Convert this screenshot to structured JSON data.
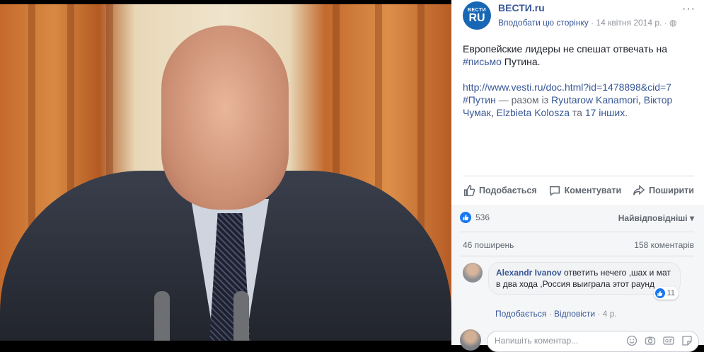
{
  "page": {
    "name": "ВЕСТИ.ru",
    "avatar_top": "ВЕСТИ",
    "avatar_bottom": "RU",
    "follow": "Вподобати цю сторінку",
    "dot": " · ",
    "date": "14 квітня 2014 р.",
    "globe": "· ◍",
    "more": "···"
  },
  "post": {
    "text_before_tag": "Европейские лидеры не спешат отвечать на ",
    "hashtag": "#письмо",
    "text_after_tag": " Путина.",
    "url": "http://www.vesti.ru/doc.html?id=1478898&cid=7",
    "tag2": "#Путин",
    "with": " — разом із ",
    "person1": "Ryutarow Kanamori",
    "comma1": ", ",
    "person2": "Віктор Чумак",
    "comma2": ", ",
    "person3": "Elzbieta Kolosza",
    "and": " та ",
    "others": "17 інших",
    "end": "."
  },
  "actions": {
    "like": "Подобається",
    "comment": "Коментувати",
    "share": "Поширити"
  },
  "stats": {
    "likes": "536",
    "sort": "Найвідповідніші ▾",
    "shares": "46 поширень",
    "comments": "158 коментарів"
  },
  "comment": {
    "author": "Alexandr Ivanov",
    "text": " ответить нечего ,шах и мат в два хода ,Россия выиграла этот раунд",
    "likes": "11",
    "like_link": "Подобається",
    "reply_link": "Відповісти",
    "age": "4 р.",
    "sep": " · "
  },
  "composer": {
    "placeholder": "Напишіть коментар..."
  }
}
